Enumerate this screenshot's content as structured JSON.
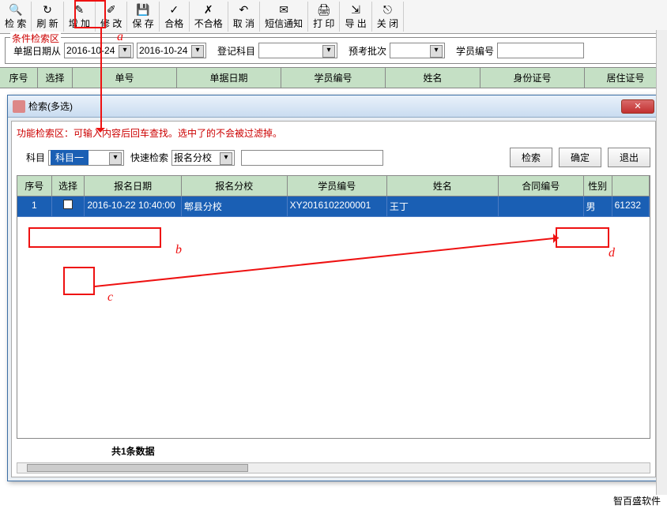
{
  "toolbar": [
    {
      "icon": "🔍",
      "label": "检 索"
    },
    {
      "icon": "↻",
      "label": "刷 新"
    },
    {
      "icon": "✎",
      "label": "增 加"
    },
    {
      "icon": "✐",
      "label": "修 改"
    },
    {
      "icon": "💾",
      "label": "保 存"
    },
    {
      "icon": "✓",
      "label": "合格"
    },
    {
      "icon": "✗",
      "label": "不合格"
    },
    {
      "icon": "↶",
      "label": "取 消"
    },
    {
      "icon": "✉",
      "label": "短信通知"
    },
    {
      "icon": "🖨",
      "label": "打 印"
    },
    {
      "icon": "⇲",
      "label": "导 出"
    },
    {
      "icon": "⎋",
      "label": "关 闭"
    }
  ],
  "cond": {
    "title": "条件检索区",
    "date_label": "单据日期从",
    "date_from": "2016-10-24",
    "date_to": "2016-10-24",
    "reg_subject_label": "登记科目",
    "pre_batch_label": "预考批次",
    "student_no_label": "学员编号"
  },
  "main_cols": [
    "序号",
    "选择",
    "单号",
    "单据日期",
    "学员编号",
    "姓名",
    "身份证号",
    "居住证号"
  ],
  "dialog": {
    "title": "检索(多选)",
    "hint": "功能检索区：可输入内容后回车查找。选中了的不会被过滤掉。",
    "subject_label": "科目",
    "subject_value": "科目一",
    "quick_label": "快速检索",
    "quick_value": "报名分校",
    "btn_search": "检索",
    "btn_ok": "确定",
    "btn_exit": "退出",
    "sub_cols": [
      "序号",
      "选择",
      "报名日期",
      "报名分校",
      "学员编号",
      "姓名",
      "合同编号",
      "性别",
      ""
    ],
    "row": {
      "no": "1",
      "date": "2016-10-22 10:40:00",
      "branch": "郫县分校",
      "student_no": "XY2016102200001",
      "name": "王丁",
      "contract": "",
      "gender": "男",
      "extra": "61232"
    },
    "count": "共1条数据"
  },
  "annotations": {
    "a": "a",
    "b": "b",
    "c": "c",
    "d": "d"
  },
  "brand": "智百盛软件"
}
